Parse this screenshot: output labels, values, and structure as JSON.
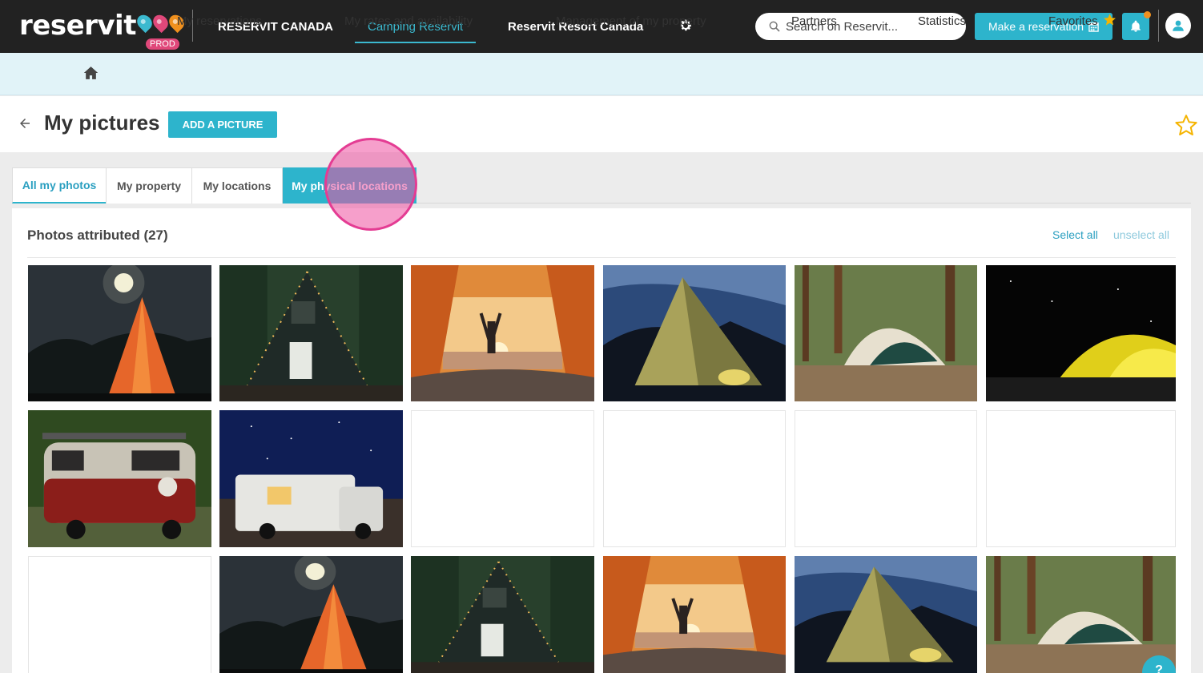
{
  "header": {
    "logo_text": "reservit",
    "env_badge": "PROD",
    "nav": [
      "RESERVIT CANADA",
      "Camping Reservit",
      "Reservit Resort Canada"
    ],
    "search_placeholder": "Search on Reservit...",
    "make_reservation_label": "Make a reservation",
    "brand_color": "#2db4cc",
    "icons": [
      "settings-icon",
      "search-icon",
      "calendar-icon",
      "bell-icon",
      "user-icon"
    ]
  },
  "subnav": {
    "items": [
      "My reservations",
      "My rates and availability",
      "Management of my property",
      "Partners",
      "Statistics",
      "Favorites"
    ]
  },
  "page": {
    "title": "My pictures",
    "add_button": "ADD A PICTURE"
  },
  "tabs": [
    "All my photos",
    "My property",
    "My locations",
    "My physical locations"
  ],
  "photos": {
    "title": "Photos attributed (27)",
    "select_all": "Select all",
    "unselect_all": "unselect all",
    "items": [
      "teepee-night",
      "a-frame-cabin",
      "tent-sunrise",
      "tent-night-sky",
      "dome-tent-forest",
      "yellow-tent-night",
      "vw-van",
      "rv-starry-night",
      "empty",
      "empty",
      "empty",
      "empty",
      "empty",
      "teepee-night",
      "a-frame-cabin",
      "tent-sunrise",
      "tent-night-sky",
      "dome-tent-forest"
    ]
  },
  "help_label": "?"
}
